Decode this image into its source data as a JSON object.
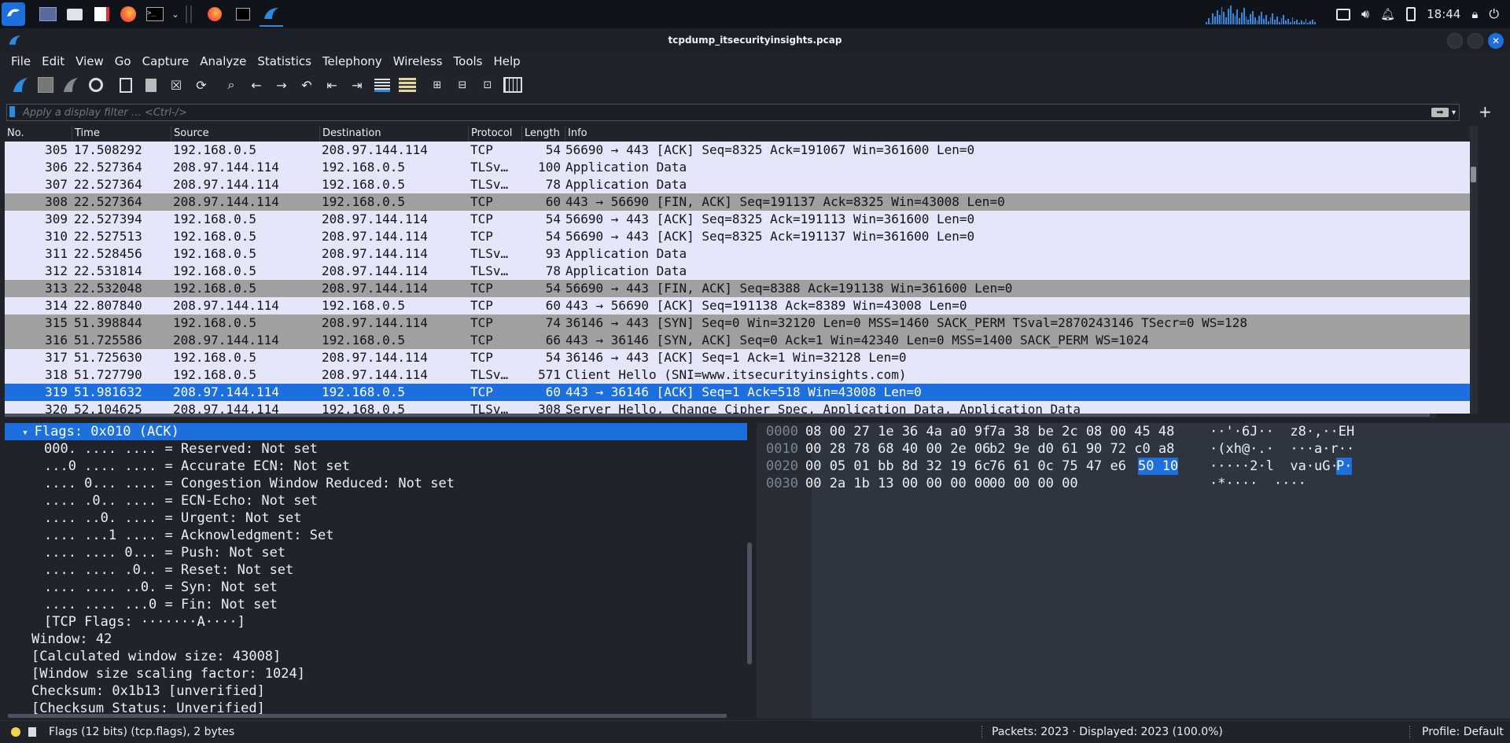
{
  "window": {
    "title": "tcpdump_itsecurityinsights.pcap"
  },
  "taskbar": {
    "clock": "18:44"
  },
  "menu": [
    "File",
    "Edit",
    "View",
    "Go",
    "Capture",
    "Analyze",
    "Statistics",
    "Telephony",
    "Wireless",
    "Tools",
    "Help"
  ],
  "filter": {
    "placeholder": "Apply a display filter … <Ctrl-/>"
  },
  "columns": {
    "no": "No.",
    "time": "Time",
    "source": "Source",
    "destination": "Destination",
    "protocol": "Protocol",
    "length": "Length",
    "info": "Info"
  },
  "packets": [
    {
      "no": "305",
      "time": "17.508292",
      "src": "192.168.0.5",
      "dst": "208.97.144.114",
      "proto": "TCP",
      "len": "54",
      "info": "56690 → 443 [ACK] Seq=8325 Ack=191067 Win=361600 Len=0",
      "style": "lav"
    },
    {
      "no": "306",
      "time": "22.527364",
      "src": "208.97.144.114",
      "dst": "192.168.0.5",
      "proto": "TLSv…",
      "len": "100",
      "info": "Application Data",
      "style": "lav"
    },
    {
      "no": "307",
      "time": "22.527364",
      "src": "208.97.144.114",
      "dst": "192.168.0.5",
      "proto": "TLSv…",
      "len": "78",
      "info": "Application Data",
      "style": "lav"
    },
    {
      "no": "308",
      "time": "22.527364",
      "src": "208.97.144.114",
      "dst": "192.168.0.5",
      "proto": "TCP",
      "len": "60",
      "info": "443 → 56690 [FIN, ACK] Seq=191137 Ack=8325 Win=43008 Len=0",
      "style": "gray"
    },
    {
      "no": "309",
      "time": "22.527394",
      "src": "192.168.0.5",
      "dst": "208.97.144.114",
      "proto": "TCP",
      "len": "54",
      "info": "56690 → 443 [ACK] Seq=8325 Ack=191113 Win=361600 Len=0",
      "style": "lav"
    },
    {
      "no": "310",
      "time": "22.527513",
      "src": "192.168.0.5",
      "dst": "208.97.144.114",
      "proto": "TCP",
      "len": "54",
      "info": "56690 → 443 [ACK] Seq=8325 Ack=191137 Win=361600 Len=0",
      "style": "lav"
    },
    {
      "no": "311",
      "time": "22.528456",
      "src": "192.168.0.5",
      "dst": "208.97.144.114",
      "proto": "TLSv…",
      "len": "93",
      "info": "Application Data",
      "style": "lav"
    },
    {
      "no": "312",
      "time": "22.531814",
      "src": "192.168.0.5",
      "dst": "208.97.144.114",
      "proto": "TLSv…",
      "len": "78",
      "info": "Application Data",
      "style": "lav"
    },
    {
      "no": "313",
      "time": "22.532048",
      "src": "192.168.0.5",
      "dst": "208.97.144.114",
      "proto": "TCP",
      "len": "54",
      "info": "56690 → 443 [FIN, ACK] Seq=8388 Ack=191138 Win=361600 Len=0",
      "style": "gray"
    },
    {
      "no": "314",
      "time": "22.807840",
      "src": "208.97.144.114",
      "dst": "192.168.0.5",
      "proto": "TCP",
      "len": "60",
      "info": "443 → 56690 [ACK] Seq=191138 Ack=8389 Win=43008 Len=0",
      "style": "lav"
    },
    {
      "no": "315",
      "time": "51.398844",
      "src": "192.168.0.5",
      "dst": "208.97.144.114",
      "proto": "TCP",
      "len": "74",
      "info": "36146 → 443 [SYN] Seq=0 Win=32120 Len=0 MSS=1460 SACK_PERM TSval=2870243146 TSecr=0 WS=128",
      "style": "gray"
    },
    {
      "no": "316",
      "time": "51.725586",
      "src": "208.97.144.114",
      "dst": "192.168.0.5",
      "proto": "TCP",
      "len": "66",
      "info": "443 → 36146 [SYN, ACK] Seq=0 Ack=1 Win=42340 Len=0 MSS=1400 SACK_PERM WS=1024",
      "style": "gray"
    },
    {
      "no": "317",
      "time": "51.725630",
      "src": "192.168.0.5",
      "dst": "208.97.144.114",
      "proto": "TCP",
      "len": "54",
      "info": "36146 → 443 [ACK] Seq=1 Ack=1 Win=32128 Len=0",
      "style": "lav"
    },
    {
      "no": "318",
      "time": "51.727790",
      "src": "192.168.0.5",
      "dst": "208.97.144.114",
      "proto": "TLSv…",
      "len": "571",
      "info": "Client Hello (SNI=www.itsecurityinsights.com)",
      "style": "lav"
    },
    {
      "no": "319",
      "time": "51.981632",
      "src": "208.97.144.114",
      "dst": "192.168.0.5",
      "proto": "TCP",
      "len": "60",
      "info": "443 → 36146 [ACK] Seq=1 Ack=518 Win=43008 Len=0",
      "style": "sel"
    },
    {
      "no": "320",
      "time": "52.104625",
      "src": "208.97.144.114",
      "dst": "192.168.0.5",
      "proto": "TLSv…",
      "len": "308",
      "info": "Server Hello, Change Cipher Spec, Application Data, Application Data",
      "style": "lav"
    }
  ],
  "details": [
    {
      "text": "Flags: 0x010 (ACK)",
      "indent": 1,
      "sel": true,
      "arrow": "▾"
    },
    {
      "text": "000. .... .... = Reserved: Not set",
      "indent": 3
    },
    {
      "text": "...0 .... .... = Accurate ECN: Not set",
      "indent": 3
    },
    {
      "text": ".... 0... .... = Congestion Window Reduced: Not set",
      "indent": 3
    },
    {
      "text": ".... .0.. .... = ECN-Echo: Not set",
      "indent": 3
    },
    {
      "text": ".... ..0. .... = Urgent: Not set",
      "indent": 3
    },
    {
      "text": ".... ...1 .... = Acknowledgment: Set",
      "indent": 3
    },
    {
      "text": ".... .... 0... = Push: Not set",
      "indent": 3
    },
    {
      "text": ".... .... .0.. = Reset: Not set",
      "indent": 3
    },
    {
      "text": ".... .... ..0. = Syn: Not set",
      "indent": 3
    },
    {
      "text": ".... .... ...0 = Fin: Not set",
      "indent": 3
    },
    {
      "text": "[TCP Flags: ·······A····]",
      "indent": 3
    },
    {
      "text": "Window: 42",
      "indent": 2
    },
    {
      "text": "[Calculated window size: 43008]",
      "indent": 2
    },
    {
      "text": "[Window size scaling factor: 1024]",
      "indent": 2
    },
    {
      "text": "Checksum: 0x1b13 [unverified]",
      "indent": 2
    },
    {
      "text": "[Checksum Status: Unverified]",
      "indent": 2
    }
  ],
  "hex": [
    {
      "off": "0000",
      "a": "08 00 27 1e 36 4a a0 9f",
      "b": "7a 38 be 2c 08 00 45 48",
      "hl": "",
      "ascii": "··'·6J··  z8·,··EH",
      "ahl": ""
    },
    {
      "off": "0010",
      "a": "00 28 78 68 40 00 2e 06",
      "b": "b2 9e d0 61 90 72 c0 a8",
      "hl": "",
      "ascii": "·(xh@·.·  ···a·r··",
      "ahl": ""
    },
    {
      "off": "0020",
      "a": "00 05 01 bb 8d 32 19 6c",
      "b": "76 61 0c 75 47 e6",
      "hl": "50 10",
      "ascii": "·····2·l  va·uG·",
      "ahl": "P·"
    },
    {
      "off": "0030",
      "a": "00 2a 1b 13 00 00 00 00",
      "b": "00 00 00 00",
      "hl": "",
      "ascii": "·*····  ····",
      "ahl": ""
    }
  ],
  "status": {
    "field": "Flags (12 bits) (tcp.flags), 2 bytes",
    "packets": "Packets: 2023 · Displayed: 2023 (100.0%)",
    "profile": "Profile: Default"
  },
  "colors": {
    "selected": "#1c6fdc",
    "tcp_gray": "#a0a0a0",
    "lavender": "#e6e6fa"
  }
}
